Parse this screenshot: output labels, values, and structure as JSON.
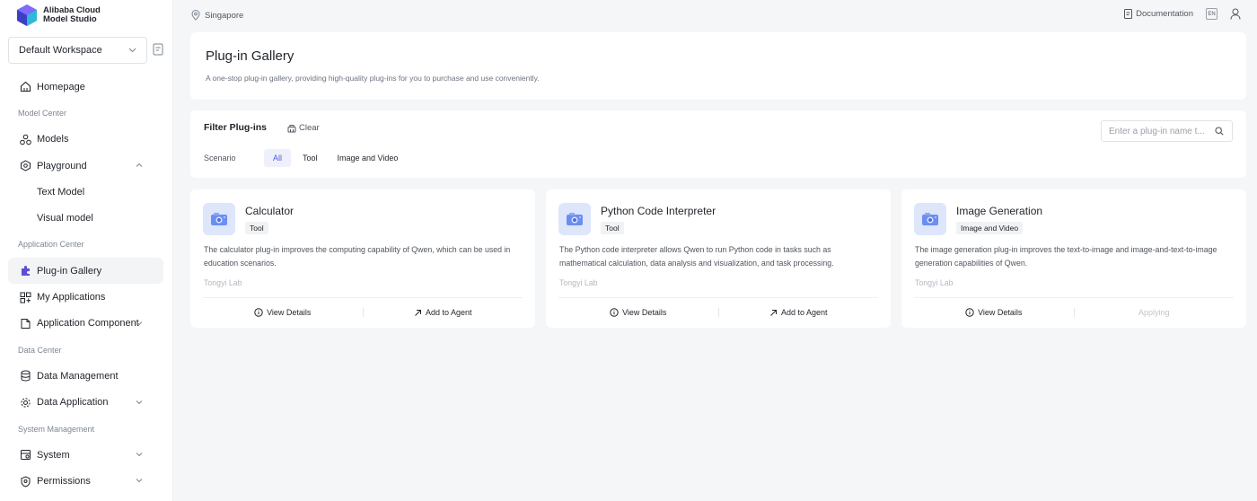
{
  "brand": {
    "line1": "Alibaba Cloud",
    "line2": "Model Studio"
  },
  "workspace": {
    "selected": "Default Workspace"
  },
  "nav": {
    "homepage": "Homepage",
    "model_center": "Model Center",
    "models": "Models",
    "playground": "Playground",
    "text_model": "Text Model",
    "visual_model": "Visual model",
    "application_center": "Application Center",
    "plugin_gallery": "Plug-in Gallery",
    "my_applications": "My Applications",
    "application_component": "Application Component",
    "data_center": "Data Center",
    "data_management": "Data Management",
    "data_application": "Data Application",
    "system_management": "System Management",
    "system": "System",
    "permissions": "Permissions"
  },
  "topbar": {
    "region": "Singapore",
    "documentation": "Documentation",
    "lang": "EN"
  },
  "header": {
    "title": "Plug-in Gallery",
    "subtitle": "A one-stop plug-in gallery, providing high-quality plug-ins for you to purchase and use conveniently."
  },
  "filter": {
    "title": "Filter Plug-ins",
    "clear": "Clear",
    "search_placeholder": "Enter a plug-in name t...",
    "scenario_label": "Scenario",
    "chips": [
      "All",
      "Tool",
      "Image and Video"
    ]
  },
  "plugins": [
    {
      "name": "Calculator",
      "tag": "Tool",
      "description": "The calculator plug-in improves the computing capability of Qwen, which can be used in education scenarios.",
      "author": "Tongyi Lab",
      "view_details": "View Details",
      "action": "Add to Agent"
    },
    {
      "name": "Python Code Interpreter",
      "tag": "Tool",
      "description": "The Python code interpreter allows Qwen to run Python code in tasks such as mathematical calculation, data analysis and visualization, and task processing.",
      "author": "Tongyi Lab",
      "view_details": "View Details",
      "action": "Add to Agent"
    },
    {
      "name": "Image Generation",
      "tag": "Image and Video",
      "description": "The image generation plug-in improves the text-to-image and image-and-text-to-image generation capabilities of Qwen.",
      "author": "Tongyi Lab",
      "view_details": "View Details",
      "action": "Applying"
    }
  ],
  "colors": {
    "accent": "#4b5bd6",
    "background": "#f5f6f8",
    "card": "#ffffff"
  }
}
